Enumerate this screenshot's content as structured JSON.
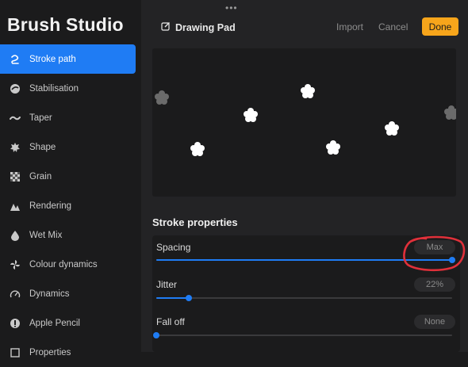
{
  "app_title": "Brush Studio",
  "sidebar": {
    "items": [
      {
        "label": "Stroke path",
        "icon": "stroke-path-icon",
        "active": true
      },
      {
        "label": "Stabilisation",
        "icon": "stabilisation-icon"
      },
      {
        "label": "Taper",
        "icon": "taper-icon"
      },
      {
        "label": "Shape",
        "icon": "shape-icon"
      },
      {
        "label": "Grain",
        "icon": "grain-icon"
      },
      {
        "label": "Rendering",
        "icon": "rendering-icon"
      },
      {
        "label": "Wet Mix",
        "icon": "wet-mix-icon"
      },
      {
        "label": "Colour dynamics",
        "icon": "colour-dynamics-icon"
      },
      {
        "label": "Dynamics",
        "icon": "dynamics-icon"
      },
      {
        "label": "Apple Pencil",
        "icon": "apple-pencil-icon"
      },
      {
        "label": "Properties",
        "icon": "properties-icon"
      }
    ]
  },
  "topbar": {
    "grip": "•••",
    "drawing_pad": "Drawing Pad",
    "import": "Import",
    "cancel": "Cancel",
    "done": "Done"
  },
  "stroke_properties": {
    "title": "Stroke properties",
    "spacing": {
      "label": "Spacing",
      "value": "Max",
      "fraction": 1.0
    },
    "jitter": {
      "label": "Jitter",
      "value": "22%",
      "fraction": 0.11
    },
    "falloff": {
      "label": "Fall off",
      "value": "None",
      "fraction": 0.0
    }
  },
  "colors": {
    "accent": "#1f7cf4",
    "done": "#f7a51b",
    "annotation": "#e0303a"
  }
}
